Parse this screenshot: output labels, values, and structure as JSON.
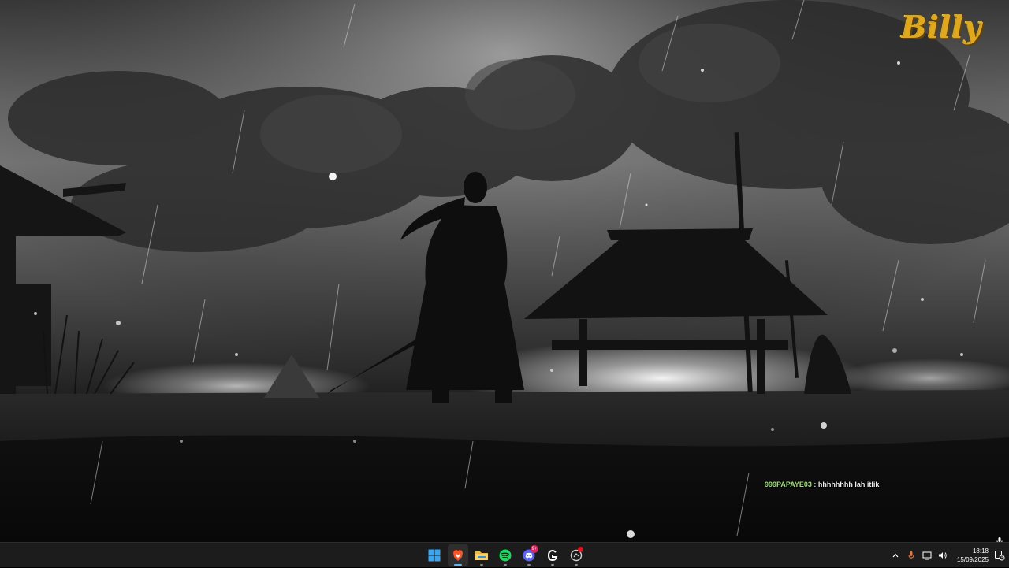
{
  "wallpaper": {
    "logo_text": "Billy",
    "scene": "samurai-in-rain"
  },
  "chat": {
    "username": "999PAPAYE03",
    "separator": ":",
    "message": "hhhhhhhh lah itlik",
    "username_color": "#9ee07a"
  },
  "taskbar": {
    "apps": [
      {
        "name": "start",
        "icon": "windows-icon",
        "active": false
      },
      {
        "name": "brave",
        "icon": "brave-lion-icon",
        "active": true
      },
      {
        "name": "file-explorer",
        "icon": "folder-icon",
        "active": false
      },
      {
        "name": "spotify",
        "icon": "spotify-icon",
        "active": false
      },
      {
        "name": "discord",
        "icon": "discord-icon",
        "active": false,
        "badge": "9+"
      },
      {
        "name": "app-g",
        "icon": "g-logo-icon",
        "active": false
      },
      {
        "name": "app-circle",
        "icon": "circle-app-icon",
        "active": false
      }
    ],
    "tray": {
      "chevron": "chevron-up-icon",
      "mic": "microphone-icon",
      "network": "monitor-network-icon",
      "volume": "speaker-icon"
    },
    "clock": {
      "time": "18:18",
      "date": "15/09/2025"
    },
    "accent_color": "#60b6ff"
  }
}
